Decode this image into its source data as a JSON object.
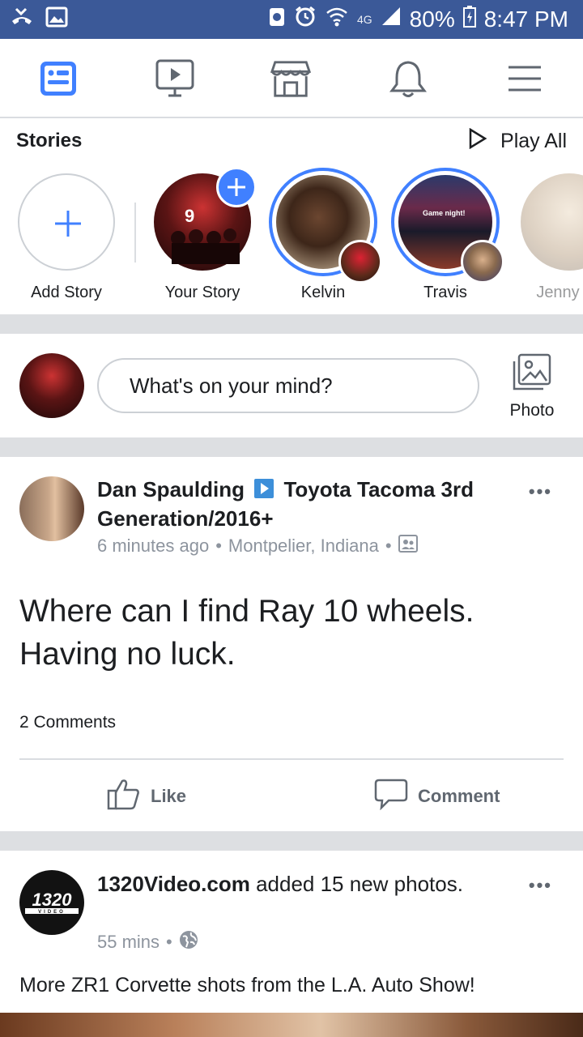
{
  "status_bar": {
    "battery": "80%",
    "time": "8:47 PM",
    "network": "4G",
    "icons": [
      "missed-call-icon",
      "image-icon",
      "save-icon",
      "alarm-icon",
      "wifi-icon",
      "signal-icon",
      "battery-icon"
    ]
  },
  "top_nav": {
    "items": [
      "news-feed-icon",
      "watch-icon",
      "marketplace-icon",
      "notifications-icon",
      "menu-icon"
    ],
    "active_color": "#4080ff"
  },
  "stories": {
    "title": "Stories",
    "play_all": "Play All",
    "items": [
      {
        "label": "Add Story"
      },
      {
        "label": "Your Story"
      },
      {
        "label": "Kelvin"
      },
      {
        "label": "Travis"
      },
      {
        "label": "Jenny"
      }
    ]
  },
  "composer": {
    "placeholder": "What's on your mind?",
    "photo_label": "Photo"
  },
  "post1": {
    "author": "Dan Spaulding",
    "group": "Toyota Tacoma 3rd Generation/2016+",
    "time": "6 minutes ago",
    "location": "Montpelier, Indiana",
    "text": "Where can I find Ray 10 wheels. Having no luck.",
    "comments": "2 Comments",
    "like": "Like",
    "comment": "Comment"
  },
  "post2": {
    "author": "1320Video.com",
    "action": "added 15 new photos.",
    "time": "55 mins",
    "text": "More ZR1 Corvette shots from the L.A. Auto Show!",
    "logo_text": "1320",
    "logo_subtext": "VIDEO"
  },
  "colors": {
    "brand": "#3b5998",
    "accent": "#4080ff",
    "separator": "#dddfe2"
  }
}
